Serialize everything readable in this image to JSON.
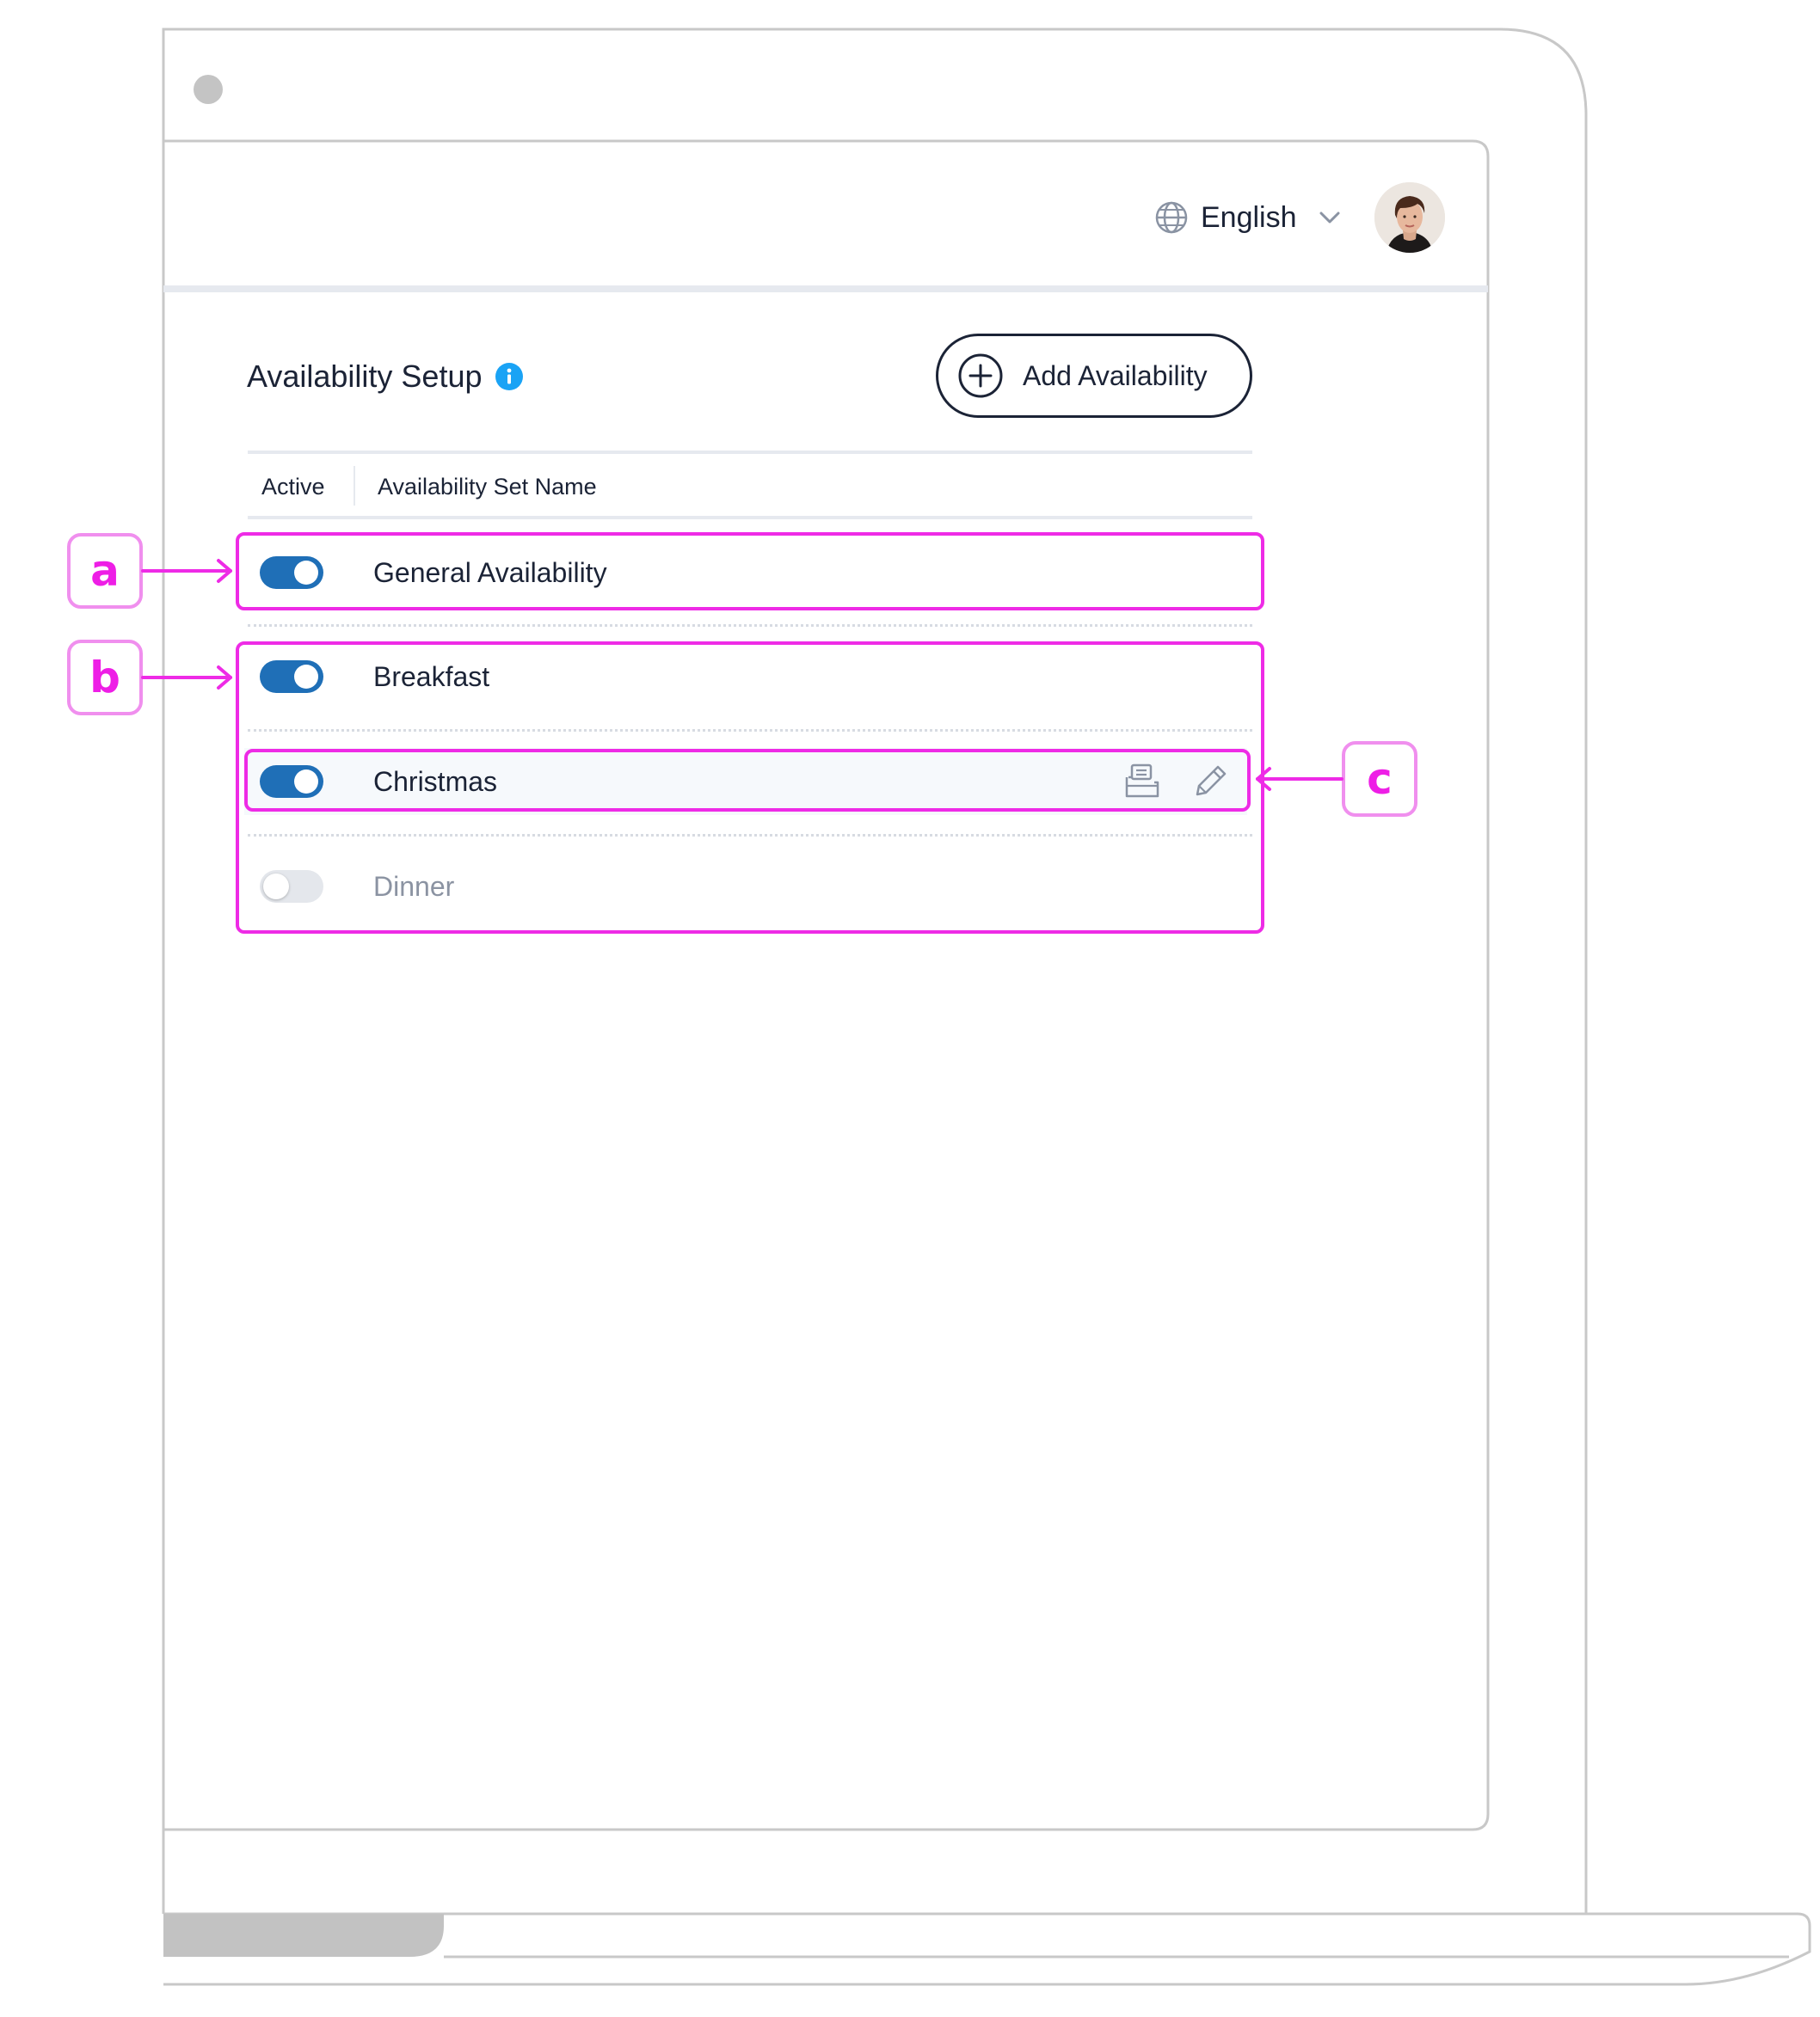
{
  "header": {
    "language_label": "English",
    "avatar_alt": "User avatar"
  },
  "page": {
    "title": "Availability Setup",
    "add_button_label": "Add Availability"
  },
  "table": {
    "columns": [
      "Active",
      "Availability Set Name"
    ],
    "rows": [
      {
        "name": "General Availability",
        "active": true
      },
      {
        "name": "Breakfast",
        "active": true
      },
      {
        "name": "Christmas",
        "active": true,
        "hovered": true,
        "actions": [
          "copy-icon",
          "edit-icon"
        ]
      },
      {
        "name": "Dinner",
        "active": false
      }
    ]
  },
  "annotations": {
    "callouts": [
      "a",
      "b",
      "c"
    ]
  },
  "colors": {
    "toggle_on": "#1f6fb7",
    "toggle_off": "#e4e7ec",
    "annotation": "#ee2be6",
    "info_icon": "#1aa3f5",
    "text_primary": "#1b2336"
  }
}
